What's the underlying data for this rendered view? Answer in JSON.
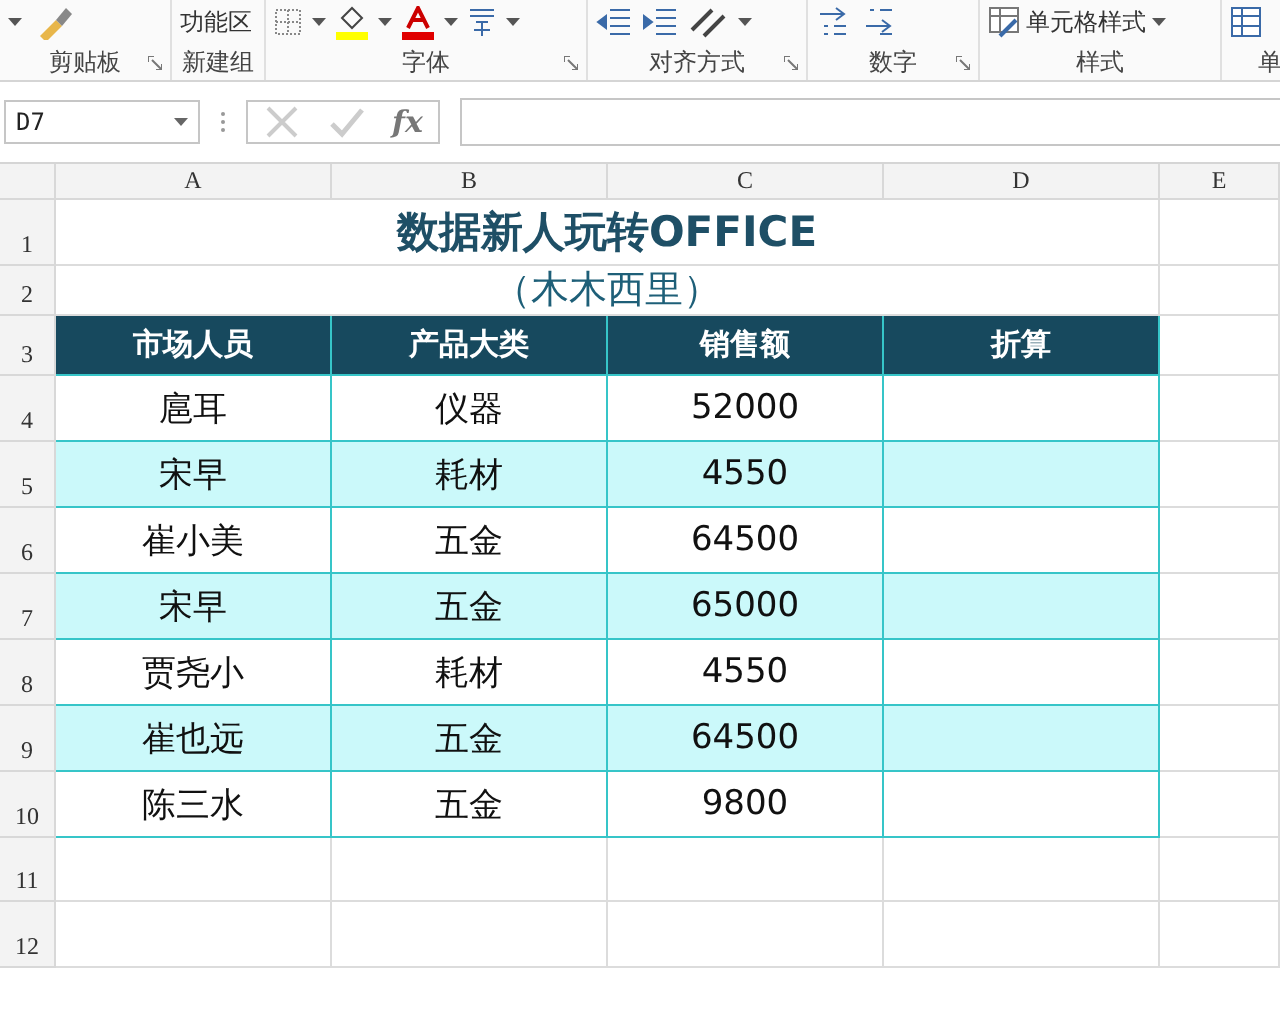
{
  "ribbon": {
    "groups": [
      {
        "label": "剪贴板",
        "launcher": true,
        "items": [
          {
            "kind": "dropdown"
          },
          {
            "kind": "brush"
          }
        ]
      },
      {
        "label": "新建组",
        "launcher": false,
        "items": [
          {
            "kind": "text",
            "label": "功能区"
          }
        ]
      },
      {
        "label": "字体",
        "launcher": true,
        "items": [
          {
            "kind": "border"
          },
          {
            "kind": "fill-color",
            "color": "#ffff00"
          },
          {
            "kind": "font-color",
            "color": "#e00000"
          },
          {
            "kind": "phonetic"
          }
        ]
      },
      {
        "label": "对齐方式",
        "launcher": true,
        "items": [
          {
            "kind": "indent"
          },
          {
            "kind": "orientation"
          }
        ]
      },
      {
        "label": "数字",
        "launcher": true,
        "items": [
          {
            "kind": "decimal"
          }
        ]
      },
      {
        "label": "样式",
        "launcher": false,
        "items": [
          {
            "kind": "cell-style",
            "label": "单元格样式"
          }
        ]
      },
      {
        "label": "单",
        "launcher": false,
        "items": [
          {
            "kind": "table"
          }
        ]
      }
    ]
  },
  "formula_bar": {
    "name_box": "D7",
    "fx": "fx"
  },
  "columns": [
    "A",
    "B",
    "C",
    "D",
    "E"
  ],
  "rows": [
    {
      "number": "1",
      "kind": "title",
      "text": "数据新人玩转OFFICE"
    },
    {
      "number": "2",
      "kind": "subtitle",
      "text": "（木木西里）"
    },
    {
      "number": "3",
      "kind": "header",
      "cells": [
        "市场人员",
        "产品大类",
        "销售额",
        "折算"
      ]
    },
    {
      "number": "4",
      "kind": "data",
      "shaded": false,
      "cells": [
        "扈耳",
        "仪器",
        "52000"
      ]
    },
    {
      "number": "5",
      "kind": "data",
      "shaded": true,
      "cells": [
        "宋早",
        "耗材",
        "4550"
      ]
    },
    {
      "number": "6",
      "kind": "data",
      "shaded": false,
      "cells": [
        "崔小美",
        "五金",
        "64500"
      ]
    },
    {
      "number": "7",
      "kind": "data",
      "shaded": true,
      "cells": [
        "宋早",
        "五金",
        "65000"
      ]
    },
    {
      "number": "8",
      "kind": "data",
      "shaded": false,
      "cells": [
        "贾尧小",
        "耗材",
        "4550"
      ]
    },
    {
      "number": "9",
      "kind": "data",
      "shaded": true,
      "cells": [
        "崔也远",
        "五金",
        "64500"
      ]
    },
    {
      "number": "10",
      "kind": "data",
      "shaded": false,
      "cells": [
        "陈三水",
        "五金",
        "9800"
      ]
    },
    {
      "number": "11",
      "kind": "empty"
    },
    {
      "number": "12",
      "kind": "empty"
    }
  ]
}
